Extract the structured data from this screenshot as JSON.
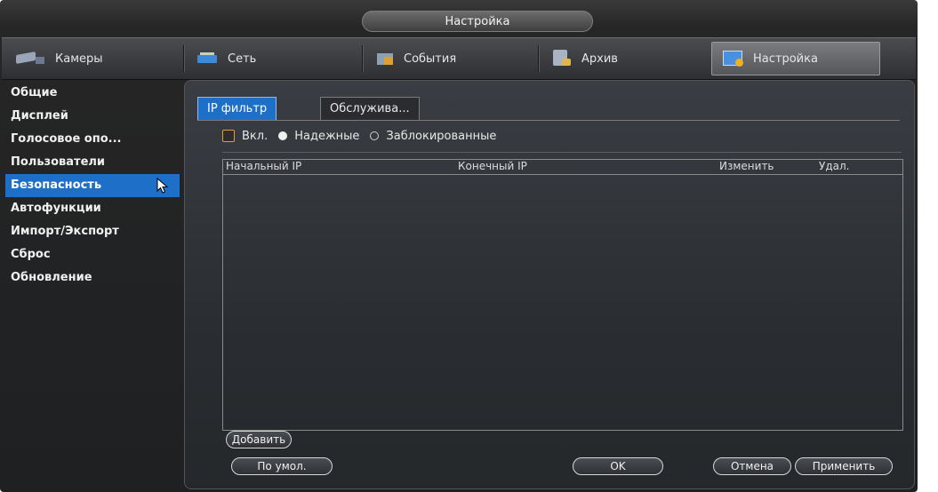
{
  "window": {
    "title": "Настройка"
  },
  "top_tabs": [
    {
      "label": "Камеры",
      "icon": "camera-icon"
    },
    {
      "label": "Сеть",
      "icon": "network-icon"
    },
    {
      "label": "События",
      "icon": "events-icon"
    },
    {
      "label": "Архив",
      "icon": "archive-icon"
    },
    {
      "label": "Настройка",
      "icon": "settings-icon",
      "active": true
    }
  ],
  "sidebar": {
    "items": [
      {
        "label": "Общие"
      },
      {
        "label": "Дисплей"
      },
      {
        "label": "Голосовое опо..."
      },
      {
        "label": "Пользователи"
      },
      {
        "label": "Безопасность",
        "active": true
      },
      {
        "label": "Автофункции"
      },
      {
        "label": "Импорт/Экспорт"
      },
      {
        "label": "Сброс"
      },
      {
        "label": "Обновление"
      }
    ]
  },
  "sub_tabs": [
    {
      "label": "IP фильтр",
      "active": true
    },
    {
      "label": "Обслужива..."
    }
  ],
  "filter": {
    "enable_label": "Вкл.",
    "enabled": false,
    "trusted_label": "Надежные",
    "blocked_label": "Заблокированные",
    "selected": "trusted"
  },
  "table": {
    "columns": [
      "Начальный IP",
      "Конечный IP",
      "Изменить",
      "Удал."
    ],
    "rows": []
  },
  "buttons": {
    "add": "Добавить",
    "default": "По умол.",
    "ok": "OK",
    "cancel": "Отмена",
    "apply": "Применить"
  },
  "colors": {
    "accent": "#1d6fc7",
    "checkbox_border": "#e0a030",
    "background": "#262626"
  }
}
